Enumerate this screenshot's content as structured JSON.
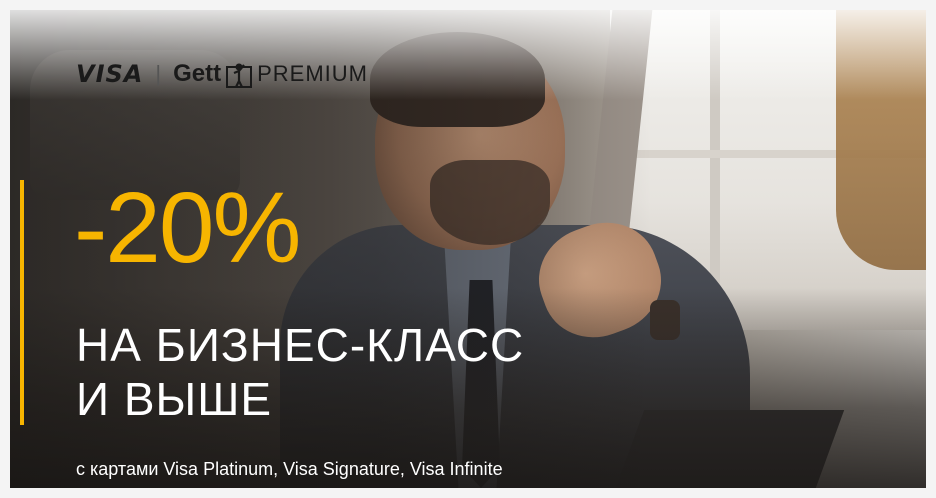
{
  "brand": {
    "visa": "VISA",
    "separator": "|",
    "gett": "Gett",
    "premium": "PREMIUM"
  },
  "offer": {
    "discount": "-20%",
    "headline_line1": "НА БИЗНЕС-КЛАСС",
    "headline_line2": "И ВЫШЕ",
    "subtext": "с картами Visa Platinum, Visa Signature, Visa Infinite"
  },
  "colors": {
    "accent": "#f7b500",
    "text_light": "#ffffff",
    "logo_dark": "#1a1a1a"
  },
  "icons": [
    "gett-person-icon"
  ]
}
